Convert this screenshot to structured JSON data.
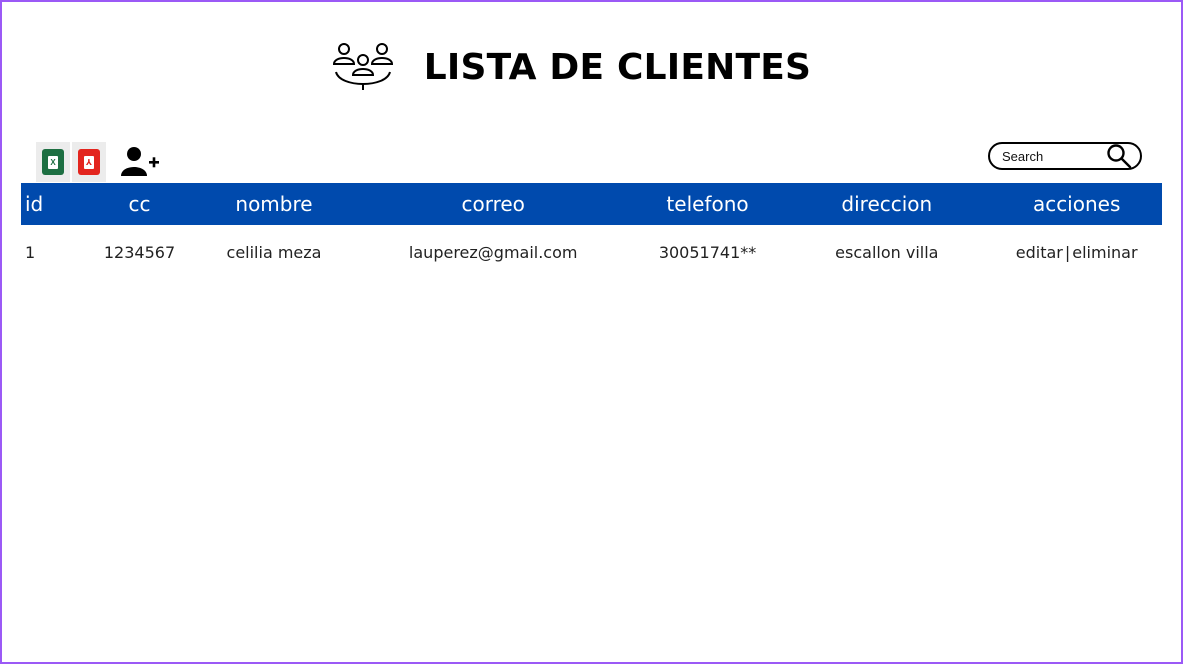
{
  "header": {
    "title": "LISTA DE CLIENTES",
    "logo_icon": "group-people-icon"
  },
  "toolbar": {
    "excel_icon": "excel-file-icon",
    "pdf_icon": "pdf-file-icon",
    "add_user_icon": "add-user-icon",
    "excel_color": "#1d6f42",
    "pdf_color": "#e3251e"
  },
  "search": {
    "placeholder": "Search",
    "icon": "search-icon"
  },
  "table": {
    "header_color": "#004aad",
    "columns": [
      "id",
      "cc",
      "nombre",
      "correo",
      "telefono",
      "direccion",
      "acciones"
    ],
    "rows": [
      {
        "id": "1",
        "cc": "1234567",
        "nombre": "celilia meza",
        "correo": "lauperez@gmail.com",
        "telefono": "30051741**",
        "direccion": "escallon villa",
        "editar": "editar",
        "separator": "|",
        "eliminar": "eliminar"
      }
    ]
  }
}
